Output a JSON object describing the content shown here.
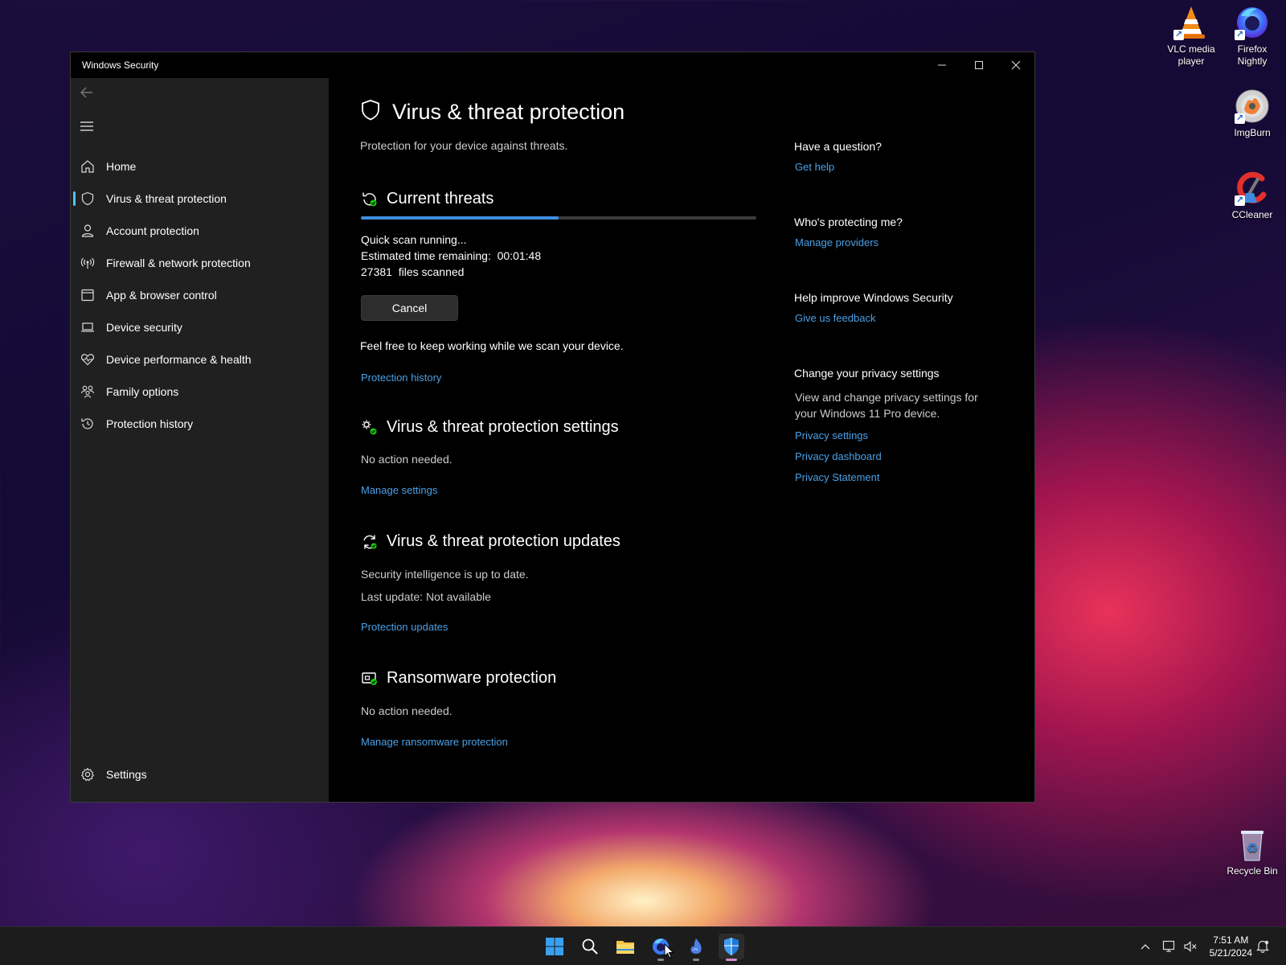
{
  "desktop": {
    "icons": [
      {
        "label": "VLC media player",
        "icon": "vlc-cone-icon"
      },
      {
        "label": "Firefox Nightly",
        "icon": "firefox-nightly-icon"
      },
      {
        "label": "ImgBurn",
        "icon": "imgburn-disc-icon"
      },
      {
        "label": "CCleaner",
        "icon": "ccleaner-icon"
      },
      {
        "label": "Recycle Bin",
        "icon": "recycle-bin-icon"
      }
    ]
  },
  "window": {
    "title": "Windows Security"
  },
  "sidebar": {
    "items": [
      {
        "label": "Home",
        "icon": "home-icon"
      },
      {
        "label": "Virus & threat protection",
        "icon": "shield-icon",
        "active": true
      },
      {
        "label": "Account protection",
        "icon": "person-icon"
      },
      {
        "label": "Firewall & network protection",
        "icon": "antenna-icon"
      },
      {
        "label": "App & browser control",
        "icon": "app-window-icon"
      },
      {
        "label": "Device security",
        "icon": "laptop-icon"
      },
      {
        "label": "Device performance & health",
        "icon": "heart-icon"
      },
      {
        "label": "Family options",
        "icon": "family-icon"
      },
      {
        "label": "Protection history",
        "icon": "history-icon"
      }
    ],
    "settings_label": "Settings"
  },
  "main": {
    "title": "Virus & threat protection",
    "subtitle": "Protection for your device against threats.",
    "current_threats": {
      "heading": "Current threats",
      "scan_status": "Quick scan running...",
      "time_remaining": "Estimated time remaining:  00:01:48",
      "files_scanned": "27381  files scanned",
      "progress_fraction": 0.5,
      "cancel_label": "Cancel",
      "note": "Feel free to keep working while we scan your device.",
      "history_link": "Protection history"
    },
    "settings_section": {
      "heading": "Virus & threat protection settings",
      "status": "No action needed.",
      "link": "Manage settings"
    },
    "updates_section": {
      "heading": "Virus & threat protection updates",
      "status": "Security intelligence is up to date.",
      "last_update": "Last update: Not available",
      "link": "Protection updates"
    },
    "ransomware_section": {
      "heading": "Ransomware protection",
      "status": "No action needed.",
      "link": "Manage ransomware protection"
    }
  },
  "right_panel": {
    "question": {
      "heading": "Have a question?",
      "link": "Get help"
    },
    "protecting": {
      "heading": "Who's protecting me?",
      "link": "Manage providers"
    },
    "improve": {
      "heading": "Help improve Windows Security",
      "link": "Give us feedback"
    },
    "privacy": {
      "heading": "Change your privacy settings",
      "text": "View and change privacy settings for your Windows 11 Pro device.",
      "links": [
        "Privacy settings",
        "Privacy dashboard",
        "Privacy Statement"
      ]
    }
  },
  "taskbar": {
    "time": "7:51 AM",
    "date": "5/21/2024"
  },
  "colors": {
    "accent": "#4cc2ff",
    "link": "#4aa0e6",
    "progress": "#3f8ee0",
    "sidebar_bg": "#202020",
    "content_bg": "#000000"
  }
}
